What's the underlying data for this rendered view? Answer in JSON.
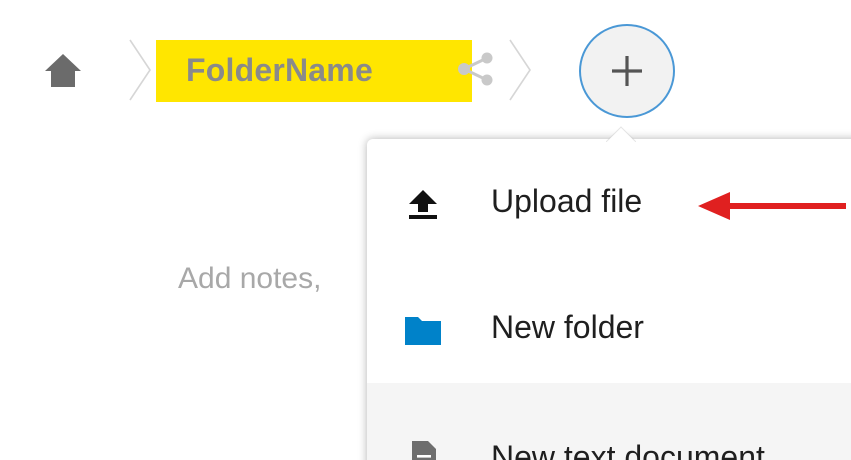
{
  "breadcrumb": {
    "home_icon": "home-icon",
    "folder_name": "FolderName",
    "folder_highlight_color": "#ffe600",
    "share_icon": "share-icon",
    "separator_icon": "chevron-right-icon"
  },
  "add_button": {
    "icon": "plus-icon",
    "border_color": "#4a98d6"
  },
  "notes": {
    "placeholder": "Add notes,"
  },
  "new_menu": {
    "items": [
      {
        "label": "Upload file",
        "icon": "upload-icon"
      },
      {
        "label": "New folder",
        "icon": "folder-icon",
        "icon_color": "#0082c9"
      },
      {
        "label": "New text document",
        "icon": "text-document-icon"
      }
    ]
  },
  "annotation": {
    "icon": "arrow-left-icon",
    "color": "#e02020"
  }
}
